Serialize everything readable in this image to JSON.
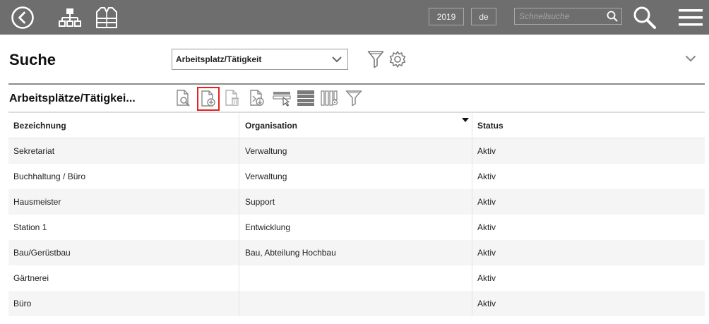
{
  "header": {
    "year": "2019",
    "language": "de",
    "search_placeholder": "Schnellsuche"
  },
  "page": {
    "title": "Suche",
    "filter_select_value": "Arbeitsplatz/Tätigkeit"
  },
  "section": {
    "title": "Arbeitsplätze/Tätigkei..."
  },
  "table": {
    "columns": [
      "Bezeichnung",
      "Organisation",
      "Status"
    ],
    "rows": [
      [
        "Sekretariat",
        "Verwaltung",
        "Aktiv"
      ],
      [
        "Buchhaltung / Büro",
        "Verwaltung",
        "Aktiv"
      ],
      [
        "Hausmeister",
        "Support",
        "Aktiv"
      ],
      [
        "Station 1",
        "Entwicklung",
        "Aktiv"
      ],
      [
        "Bau/Gerüstbau",
        "Bau, Abteilung Hochbau",
        "Aktiv"
      ],
      [
        "Gärtnerei",
        "",
        "Aktiv"
      ],
      [
        "Büro",
        "",
        "Aktiv"
      ]
    ]
  },
  "colors": {
    "topbar": "#6e6e6e",
    "active_tool_border": "#e32222"
  }
}
